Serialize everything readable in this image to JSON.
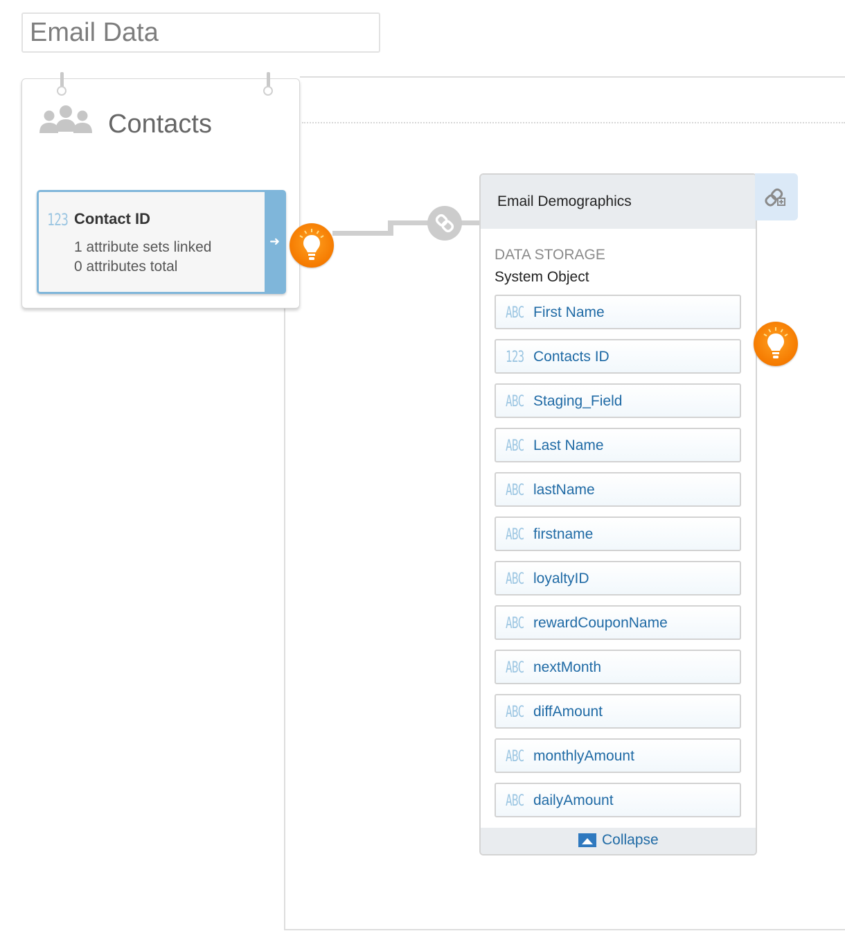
{
  "page": {
    "title_input_value": "Email Data"
  },
  "contacts_card": {
    "title": "Contacts",
    "icon": "contacts-group-icon",
    "attribute": {
      "type_label": "123",
      "name": "Contact ID",
      "linked": "1 attribute sets linked",
      "total": "0 attributes total"
    }
  },
  "demographics_card": {
    "title": "Email Demographics",
    "storage_label": "DATA STORAGE",
    "storage_value": "System Object",
    "fields": [
      {
        "type": "ABC",
        "name": "First Name"
      },
      {
        "type": "123",
        "name": "Contacts ID"
      },
      {
        "type": "ABC",
        "name": "Staging_Field"
      },
      {
        "type": "ABC",
        "name": "Last Name"
      },
      {
        "type": "ABC",
        "name": "lastName"
      },
      {
        "type": "ABC",
        "name": "firstname"
      },
      {
        "type": "ABC",
        "name": "loyaltyID"
      },
      {
        "type": "ABC",
        "name": "rewardCouponName"
      },
      {
        "type": "ABC",
        "name": "nextMonth"
      },
      {
        "type": "ABC",
        "name": "diffAmount"
      },
      {
        "type": "ABC",
        "name": "monthlyAmount"
      },
      {
        "type": "ABC",
        "name": "dailyAmount"
      }
    ],
    "collapse_label": "Collapse"
  },
  "colors": {
    "accent_blue": "#7fb6da",
    "field_text": "#1f6aa5",
    "bulb_orange": "#f57a00"
  }
}
